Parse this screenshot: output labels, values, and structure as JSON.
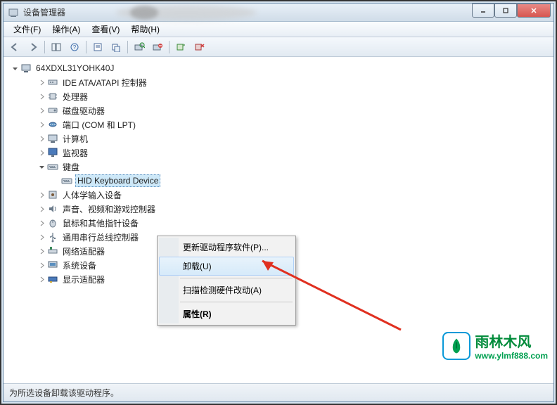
{
  "titlebar": {
    "title": "设备管理器"
  },
  "menus": {
    "file": "文件(F)",
    "action": "操作(A)",
    "view": "查看(V)",
    "help": "帮助(H)"
  },
  "tree": {
    "root": "64XDXL31YOHK40J",
    "items": [
      "IDE ATA/ATAPI 控制器",
      "处理器",
      "磁盘驱动器",
      "端口 (COM 和 LPT)",
      "计算机",
      "监视器",
      "键盘",
      "人体学输入设备",
      "声音、视频和游戏控制器",
      "鼠标和其他指针设备",
      "通用串行总线控制器",
      "网络适配器",
      "系统设备",
      "显示适配器"
    ],
    "keyboard_child": "HID Keyboard Device"
  },
  "context": {
    "update": "更新驱动程序软件(P)...",
    "uninstall": "卸载(U)",
    "scan": "扫描检测硬件改动(A)",
    "props": "属性(R)"
  },
  "statusbar": {
    "text": "为所选设备卸载该驱动程序。"
  },
  "watermark": {
    "cn": "雨林木风",
    "url": "www.ylmf888.com"
  }
}
